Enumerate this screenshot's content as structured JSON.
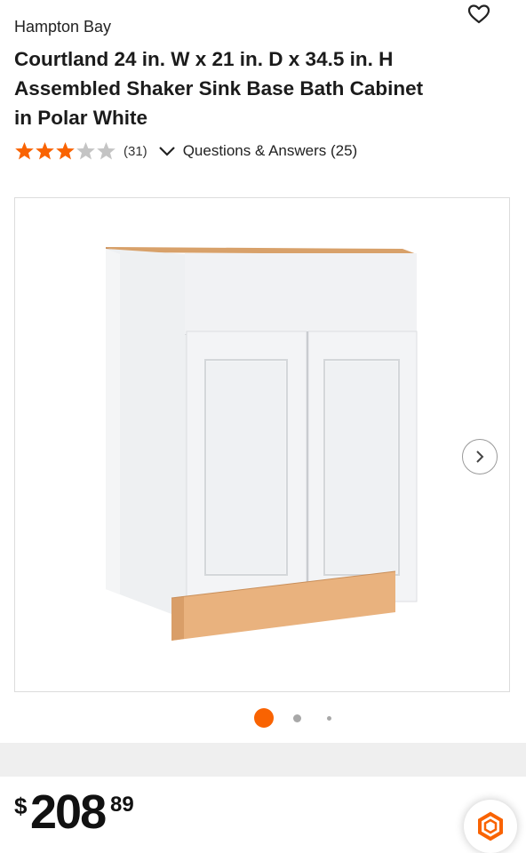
{
  "product": {
    "brand": "Hampton Bay",
    "title": "Courtland 24 in. W x 21 in. D x 34.5 in. H Assembled Shaker Sink Base Bath Cabinet in Polar White",
    "rating": 3,
    "rating_max": 5,
    "review_count": "(31)",
    "qa_label": "Questions & Answers (25)"
  },
  "icons": {
    "favorite": "heart-outline-icon",
    "star_filled": "star-filled-icon",
    "star_empty": "star-empty-icon",
    "expand": "chevron-down-icon",
    "next": "chevron-right-icon",
    "assistant": "hexagon-assistant-icon"
  },
  "gallery": {
    "image_alt_name": "sink-base-cabinet-image",
    "current_index": 1,
    "total_images": 3
  },
  "price": {
    "currency_symbol": "$",
    "dollars": "208",
    "cents": "89"
  },
  "colors": {
    "accent": "#F96302",
    "star_empty": "#C4C4C4",
    "text": "#1B1B1B"
  }
}
